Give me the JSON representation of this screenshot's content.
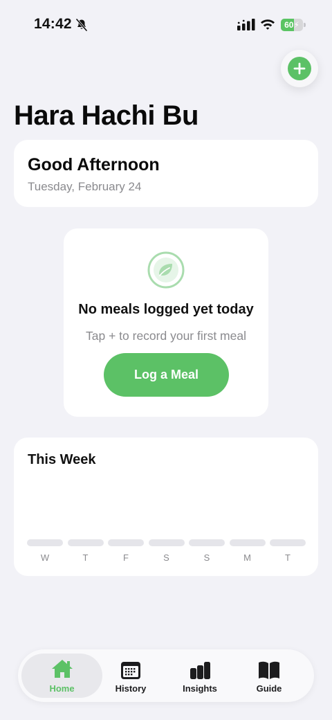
{
  "status_bar": {
    "time": "14:42",
    "battery_level": "60",
    "battery_fraction": 0.6
  },
  "colors": {
    "accent": "#5cc166",
    "background": "#f2f2f7",
    "card": "#ffffff",
    "muted_text": "#8a8a8e",
    "bar_empty": "#e5e5ea"
  },
  "header": {
    "title": "Hara Hachi Bu",
    "add_icon": "plus-icon"
  },
  "greeting": {
    "title": "Good Afternoon",
    "date": "Tuesday, February 24"
  },
  "empty_state": {
    "icon": "leaf-icon",
    "title": "No meals logged yet today",
    "subtitle": "Tap + to record your first meal",
    "button_label": "Log a Meal"
  },
  "week": {
    "title": "This Week",
    "days": [
      {
        "label": "W"
      },
      {
        "label": "T"
      },
      {
        "label": "F"
      },
      {
        "label": "S"
      },
      {
        "label": "S"
      },
      {
        "label": "M"
      },
      {
        "label": "T"
      }
    ]
  },
  "tabs": [
    {
      "label": "Home",
      "icon": "house-icon",
      "active": true
    },
    {
      "label": "History",
      "icon": "calendar-icon",
      "active": false
    },
    {
      "label": "Insights",
      "icon": "bar-chart-icon",
      "active": false
    },
    {
      "label": "Guide",
      "icon": "book-icon",
      "active": false
    }
  ]
}
